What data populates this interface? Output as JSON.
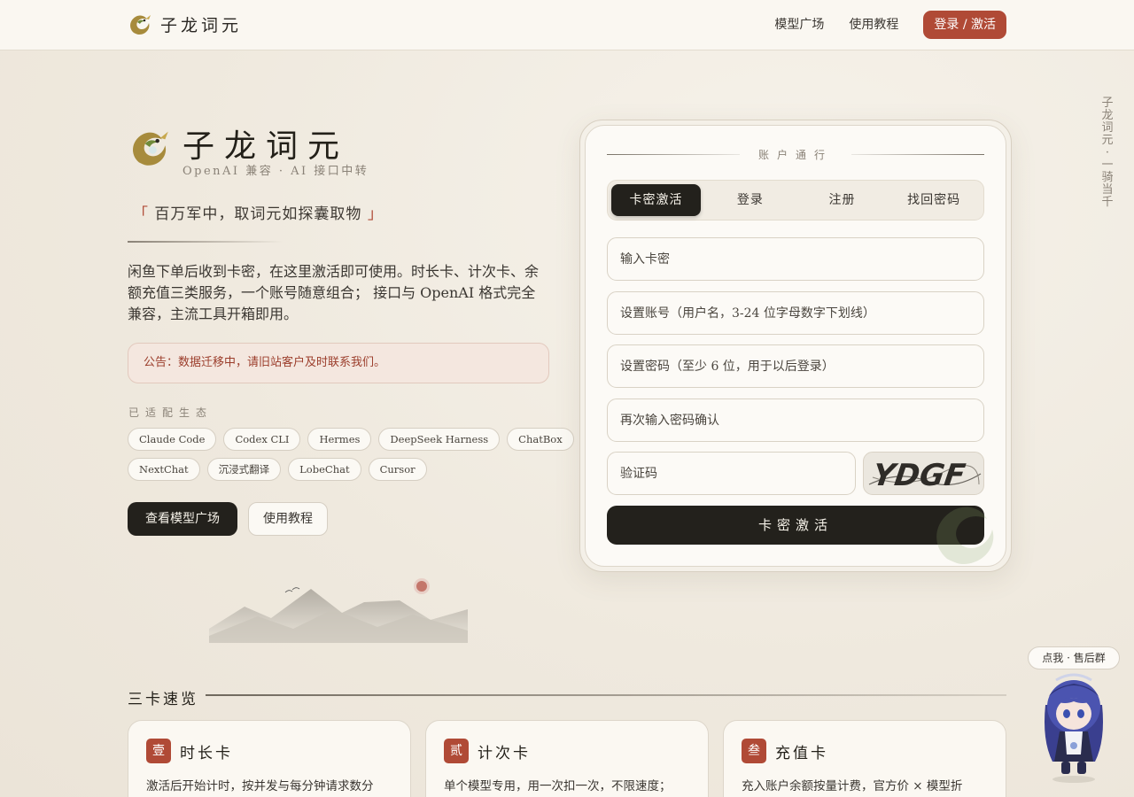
{
  "header": {
    "brand_name": "子龙词元",
    "nav": {
      "models": "模型广场",
      "tutorial": "使用教程",
      "login": "登录 / 激活"
    }
  },
  "hero": {
    "title": "子龙词元",
    "subtitle": "OpenAI 兼容 · AI 接口中转",
    "slogan_open": "「",
    "slogan": "百万军中，取词元如探囊取物",
    "slogan_close": "」",
    "description": "闲鱼下单后收到卡密，在这里激活即可使用。时长卡、计次卡、余额充值三类服务，一个账号随意组合； 接口与 OpenAI 格式完全兼容，主流工具开箱即用。",
    "notice": "公告：数据迁移中，请旧站客户及时联系我们。",
    "eco_title": "已适配生态",
    "chips_row1": [
      "Claude Code",
      "Codex CLI",
      "Hermes",
      "DeepSeek Harness",
      "ChatBox"
    ],
    "chips_row2": [
      "NextChat",
      "沉浸式翻译",
      "LobeChat",
      "Cursor"
    ],
    "btn_models": "查看模型广场",
    "btn_tutorial": "使用教程"
  },
  "panel": {
    "heading": "账户通行",
    "tabs": [
      "卡密激活",
      "登录",
      "注册",
      "找回密码"
    ],
    "fields": {
      "card_key": "输入卡密",
      "username": "设置账号（用户名，3-24 位字母数字下划线）",
      "password": "设置密码（至少 6 位，用于以后登录）",
      "password_confirm": "再次输入密码确认",
      "captcha": "验证码"
    },
    "captcha_text": "YDGF",
    "submit": "卡密激活"
  },
  "side_motto": "子龙词元·一骑当千",
  "section": {
    "title": "三卡速览",
    "cards": [
      {
        "badge": "壹",
        "title": "时长卡",
        "text": "激活后开始计时，按并发与每分钟请求数分"
      },
      {
        "badge": "贰",
        "title": "计次卡",
        "text": "单个模型专用，用一次扣一次，不限速度；"
      },
      {
        "badge": "叁",
        "title": "充值卡",
        "text": "充入账户余额按量计费，官方价 × 模型折"
      }
    ]
  },
  "help_bubble": "点我 · 售后群",
  "colors": {
    "accent": "#b04a36",
    "dark": "#23211c",
    "background": "#f2ede3"
  },
  "icons": {
    "logo": "dragon-icon",
    "mascot": "anime-girl-mascot"
  }
}
